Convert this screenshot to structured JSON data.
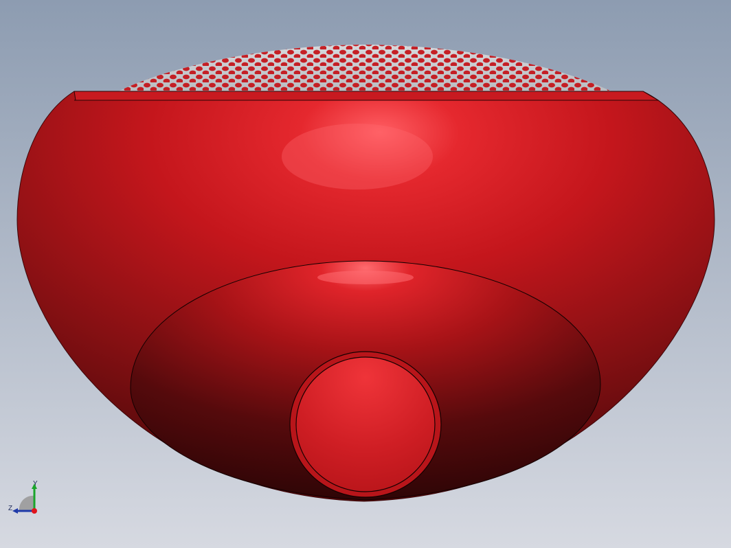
{
  "viewport": {
    "background_top": "#8d9cb1",
    "background_bottom": "#d6d9e1"
  },
  "model": {
    "body_color": "#c4161c",
    "highlight_color": "#ff5a5e",
    "shadow_color": "#3a0708",
    "edge_color": "#1a0000",
    "grille_color": "#c9ccd0",
    "hole_color": "#c4161c"
  },
  "triad": {
    "y_label": "Y",
    "z_label": "Z",
    "y_color": "#1aa52a",
    "z_color": "#1f3aa8",
    "x_color": "#e0141c"
  }
}
